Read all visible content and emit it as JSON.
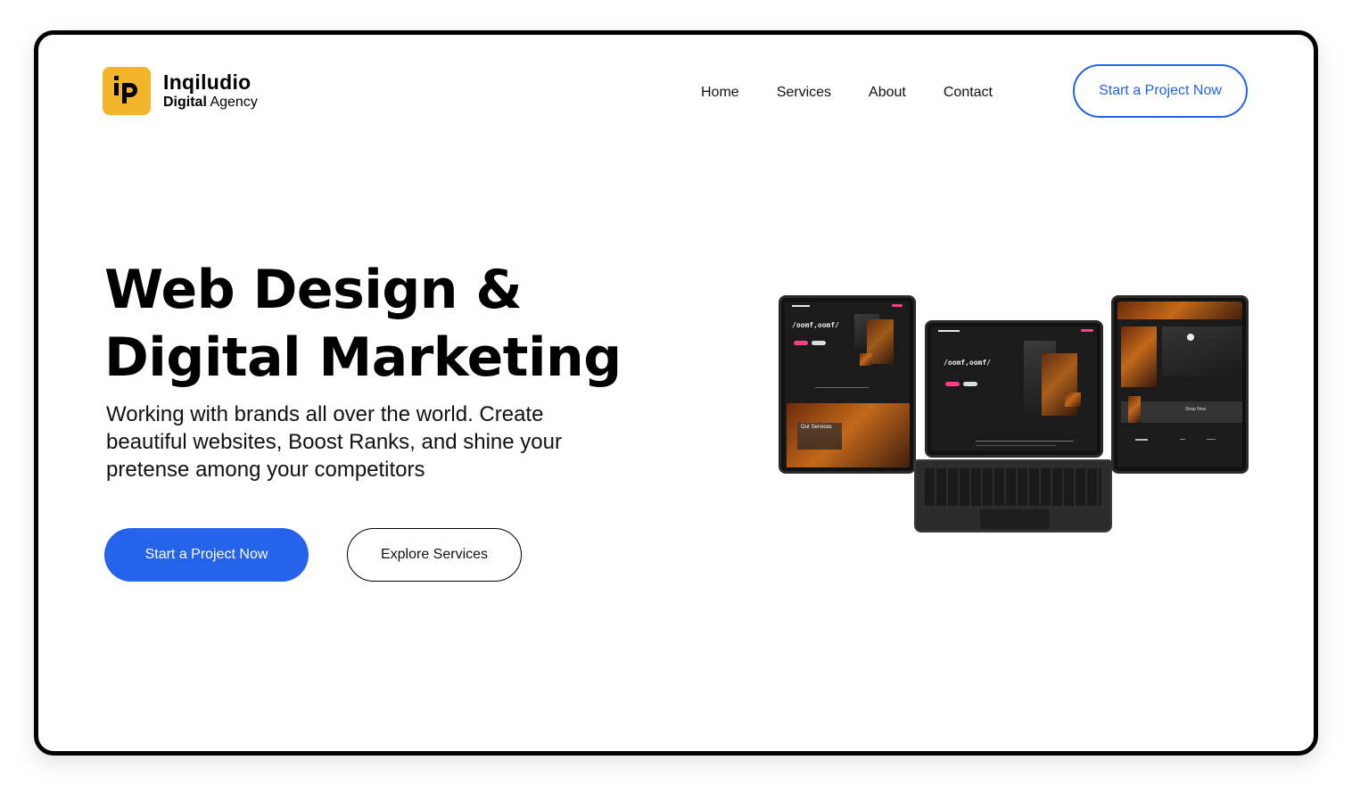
{
  "brand": {
    "name": "Inqiludio",
    "sub_bold": "Digital",
    "sub_rest": " Agency",
    "accent": "#f2b52a"
  },
  "nav": {
    "items": [
      "Home",
      "Services",
      "About",
      "Contact"
    ],
    "cta": "Start a Project Now"
  },
  "hero": {
    "headline_line1": "Web Design &",
    "headline_line2": "Digital Marketing",
    "subtext": "Working with brands all over the world. Create beautiful websites, Boost Ranks, and shine your pretense among your competitors",
    "primary_cta": "Start a Project Now",
    "secondary_cta": "Explore Services"
  },
  "mockup": {
    "hero_title": "/oomf,oomf/",
    "left_section": "Our Services",
    "right_section": "Shop Now"
  },
  "colors": {
    "primary": "#2563eb",
    "text": "#000000",
    "accent_pink": "#ff3d8b"
  }
}
